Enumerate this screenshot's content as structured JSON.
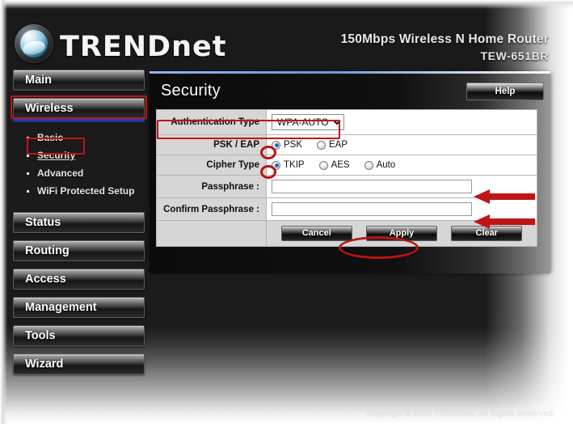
{
  "header": {
    "brand": "TRENDnet",
    "logo_icon": "trendnet-orb-icon",
    "product_line": "150Mbps Wireless N Home Router",
    "model": "TEW-651BR"
  },
  "sidebar": {
    "items": [
      {
        "label": "Main",
        "active": false
      },
      {
        "label": "Wireless",
        "active": true
      },
      {
        "label": "Status",
        "active": false
      },
      {
        "label": "Routing",
        "active": false
      },
      {
        "label": "Access",
        "active": false
      },
      {
        "label": "Management",
        "active": false
      },
      {
        "label": "Tools",
        "active": false
      },
      {
        "label": "Wizard",
        "active": false
      }
    ],
    "wireless_submenu": [
      {
        "label": "Basic",
        "current": false
      },
      {
        "label": "Security",
        "current": true
      },
      {
        "label": "Advanced",
        "current": false
      },
      {
        "label": "WiFi Protected Setup",
        "current": false
      }
    ]
  },
  "panel": {
    "title": "Security",
    "help_label": "Help"
  },
  "form": {
    "auth_type": {
      "label": "Authentication Type",
      "value": "WPA-AUTO",
      "options": [
        "WPA-AUTO"
      ]
    },
    "psk_eap": {
      "label": "PSK / EAP",
      "selected": "PSK",
      "options": [
        "PSK",
        "EAP"
      ]
    },
    "cipher_type": {
      "label": "Cipher Type",
      "selected": "TKIP",
      "options": [
        "TKIP",
        "AES",
        "Auto"
      ]
    },
    "passphrase": {
      "label": "Passphrase :",
      "value": "",
      "placeholder": ""
    },
    "confirm_passphrase": {
      "label": "Confirm Passphrase :",
      "value": "",
      "placeholder": ""
    },
    "buttons": {
      "cancel": "Cancel",
      "apply": "Apply",
      "clear": "Clear"
    }
  },
  "annotations": {
    "accent_color": "#c01515",
    "highlight_auth_type": true,
    "highlight_wireless": true,
    "highlight_security": true,
    "circle_psk_radio": true,
    "circle_tkip_radio": true,
    "circle_apply_button": true,
    "arrow_passphrase": true,
    "arrow_confirm_passphrase": true
  },
  "footer": {
    "copyright": "Copyright © 2010 TRENDnet. All Rights Reserved."
  }
}
